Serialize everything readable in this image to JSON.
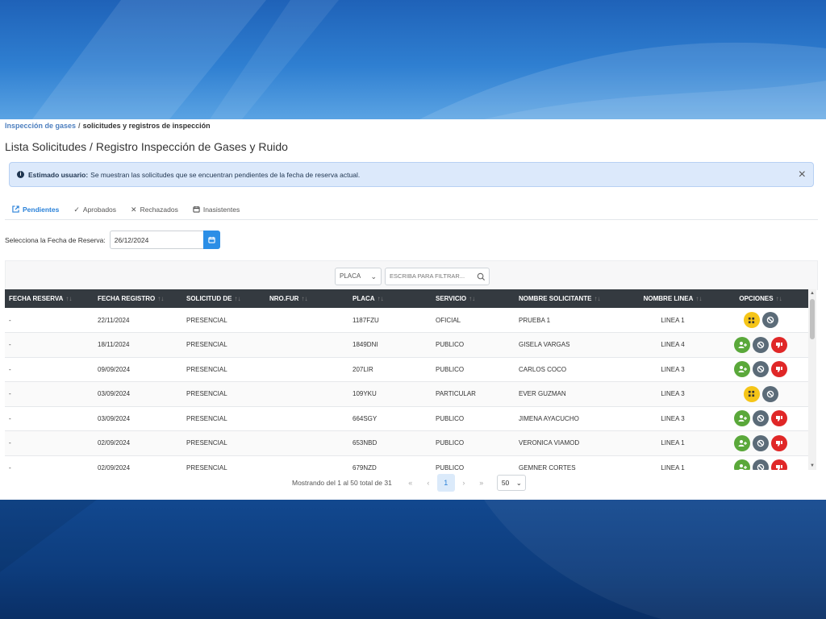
{
  "breadcrumb": {
    "parent": "Inspección de gases",
    "separator": "/",
    "current": "solicitudes y registros de inspección"
  },
  "page_title": "Lista Solicitudes / Registro Inspección de Gases y Ruido",
  "alert": {
    "strong": "Estimado usuario:",
    "message": "Se muestran las solicitudes que se encuentran pendientes de la fecha de reserva actual.",
    "info_icon": "info-icon",
    "close_icon": "close-icon"
  },
  "tabs": [
    {
      "label": "Pendientes",
      "icon": "external-link-icon",
      "active": true
    },
    {
      "label": "Aprobados",
      "icon": "check-icon",
      "active": false
    },
    {
      "label": "Rechazados",
      "icon": "x-icon",
      "active": false
    },
    {
      "label": "Inasistentes",
      "icon": "calendar-icon",
      "active": false
    }
  ],
  "date_filter": {
    "label": "Selecciona la Fecha de Reserva:",
    "value": "26/12/2024"
  },
  "filter": {
    "field": "PLACA",
    "placeholder": "ESCRIBA PARA FILTRAR..."
  },
  "table": {
    "headers": [
      "FECHA RESERVA",
      "FECHA REGISTRO",
      "SOLICITUD DE",
      "NRO.FUR",
      "PLACA",
      "SERVICIO",
      "NOMBRE SOLICITANTE",
      "NOMBRE LINEA",
      "OPCIONES"
    ],
    "rows": [
      {
        "fecha_reserva": "-",
        "fecha_registro": "22/11/2024",
        "solicitud": "PRESENCIAL",
        "nro_fur": "",
        "placa": "1187FZU",
        "servicio": "OFICIAL",
        "solicitante": "PRUEBA 1",
        "linea": "LINEA 1",
        "options": [
          "yellow",
          "gray"
        ]
      },
      {
        "fecha_reserva": "-",
        "fecha_registro": "18/11/2024",
        "solicitud": "PRESENCIAL",
        "nro_fur": "",
        "placa": "1849DNI",
        "servicio": "PUBLICO",
        "solicitante": "GISELA VARGAS",
        "linea": "LINEA 4",
        "options": [
          "green",
          "gray",
          "red"
        ]
      },
      {
        "fecha_reserva": "-",
        "fecha_registro": "09/09/2024",
        "solicitud": "PRESENCIAL",
        "nro_fur": "",
        "placa": "207LIR",
        "servicio": "PUBLICO",
        "solicitante": "CARLOS COCO",
        "linea": "LINEA 3",
        "options": [
          "green",
          "gray",
          "red"
        ]
      },
      {
        "fecha_reserva": "-",
        "fecha_registro": "03/09/2024",
        "solicitud": "PRESENCIAL",
        "nro_fur": "",
        "placa": "109YKU",
        "servicio": "PARTICULAR",
        "solicitante": "EVER GUZMAN",
        "linea": "LINEA 3",
        "options": [
          "yellow",
          "gray"
        ]
      },
      {
        "fecha_reserva": "-",
        "fecha_registro": "03/09/2024",
        "solicitud": "PRESENCIAL",
        "nro_fur": "",
        "placa": "664SGY",
        "servicio": "PUBLICO",
        "solicitante": "JIMENA AYACUCHO",
        "linea": "LINEA 3",
        "options": [
          "green",
          "gray",
          "red"
        ]
      },
      {
        "fecha_reserva": "-",
        "fecha_registro": "02/09/2024",
        "solicitud": "PRESENCIAL",
        "nro_fur": "",
        "placa": "653NBD",
        "servicio": "PUBLICO",
        "solicitante": "VERONICA VIAMOD",
        "linea": "LINEA 1",
        "options": [
          "green",
          "gray",
          "red"
        ]
      },
      {
        "fecha_reserva": "-",
        "fecha_registro": "02/09/2024",
        "solicitud": "PRESENCIAL",
        "nro_fur": "",
        "placa": "679NZD",
        "servicio": "PUBLICO",
        "solicitante": "GEMNER CORTES",
        "linea": "LINEA 1",
        "options": [
          "green",
          "gray",
          "red"
        ]
      }
    ]
  },
  "pagination": {
    "summary": "Mostrando del 1 al 50 total de 31",
    "current_page": "1",
    "per_page": "50"
  },
  "colors": {
    "accent": "#2b82d9",
    "header_bg": "#343a40",
    "yellow": "#f5c518",
    "gray": "#5b6b78",
    "green": "#5aa83a",
    "red": "#e02727"
  }
}
